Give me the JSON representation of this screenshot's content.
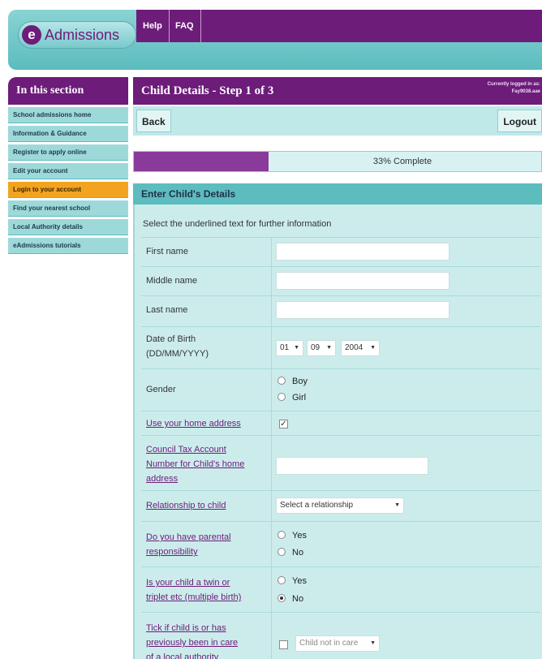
{
  "header": {
    "logo_text": "Admissions",
    "logo_letter": "e",
    "nav": [
      "Help",
      "FAQ"
    ]
  },
  "sidebar": {
    "title": "In this section",
    "items": [
      {
        "label": "School admissions home",
        "active": false
      },
      {
        "label": "Information & Guidance",
        "active": false
      },
      {
        "label": "Register to apply online",
        "active": false
      },
      {
        "label": "Edit your account",
        "active": false
      },
      {
        "label": "Login to your account",
        "active": true
      },
      {
        "label": "Find your nearest school",
        "active": false
      },
      {
        "label": "Local Authority details",
        "active": false
      },
      {
        "label": "eAdmissions tutorials",
        "active": false
      }
    ]
  },
  "page": {
    "title": "Child Details - Step 1 of 3",
    "logged_in_line1": "Currently logged in as:",
    "logged_in_line2": "Fay9038.aae",
    "back_label": "Back",
    "logout_label": "Logout",
    "progress_percent": 33,
    "progress_text": "33% Complete",
    "section_title": "Enter Child's Details",
    "instructions": "Select the underlined text for further information"
  },
  "form": {
    "first_name": {
      "label": "First name",
      "value": ""
    },
    "middle_name": {
      "label": "Middle name",
      "value": ""
    },
    "last_name": {
      "label": "Last name",
      "value": ""
    },
    "dob": {
      "label_line1": "Date of Birth",
      "label_line2": "(DD/MM/YYYY)",
      "day": "01",
      "month": "09",
      "year": "2004"
    },
    "gender": {
      "label": "Gender",
      "option1": "Boy",
      "option2": "Girl",
      "selected": null
    },
    "home_address": {
      "label": "Use your home address",
      "checked": true
    },
    "council_tax": {
      "label_line1": "Council Tax Account",
      "label_line2": "Number for Child's home",
      "label_line3": "address",
      "value": ""
    },
    "relationship": {
      "label": "Relationship to child",
      "value": "Select a relationship"
    },
    "parental": {
      "label_line1": "Do you have parental",
      "label_line2": "responsibility",
      "yes": "Yes",
      "no": "No",
      "selected": null
    },
    "twin": {
      "label_line1": "Is your child a twin or",
      "label_line2": "triplet etc (multiple birth)",
      "yes": "Yes",
      "no": "No",
      "selected": "No"
    },
    "care": {
      "label_line1": "Tick if child is or has",
      "label_line2": "previously been in care",
      "label_line3": "of a local authority",
      "value": "Child not in care"
    }
  }
}
